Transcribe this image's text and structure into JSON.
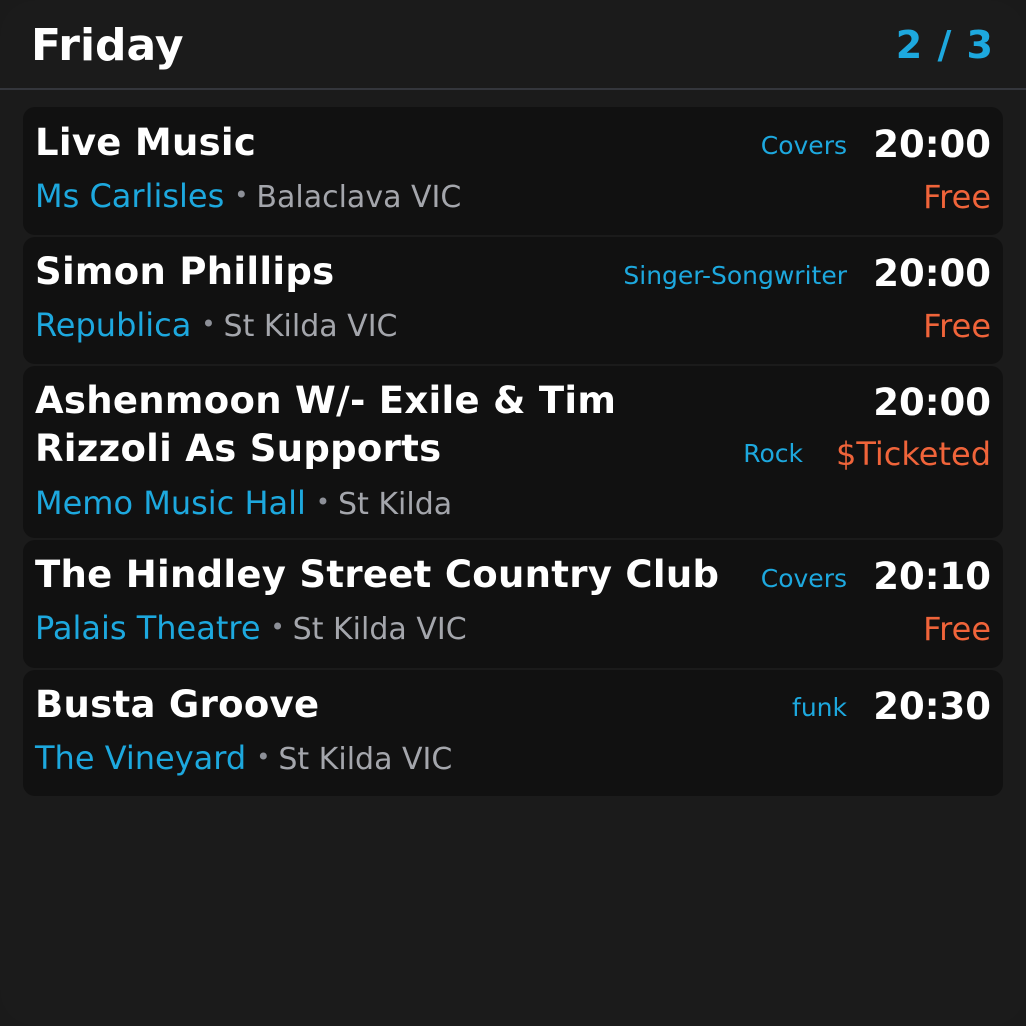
{
  "header": {
    "day": "Friday",
    "pager": "2 / 3"
  },
  "gigs": [
    {
      "title": "Live Music",
      "genre": "Covers",
      "time": "20:00",
      "venue": "Ms Carlisles",
      "suburb": "Balaclava VIC",
      "price": "Free"
    },
    {
      "title": "Simon Phillips",
      "genre": "Singer-Songwriter",
      "time": "20:00",
      "venue": "Republica",
      "suburb": "St Kilda VIC",
      "price": "Free"
    },
    {
      "title_line1": "Ashenmoon W/- Exile & Tim",
      "title_line2": "Rizzoli As Supports",
      "genre": "Rock",
      "time": "20:00",
      "venue": "Memo Music Hall",
      "suburb": "St Kilda",
      "price": "$Ticketed"
    },
    {
      "title": "The Hindley Street Country Club",
      "genre": "Covers",
      "time": "20:10",
      "venue": "Palais Theatre",
      "suburb": "St Kilda VIC",
      "price": "Free"
    },
    {
      "title": "Busta Groove",
      "genre": "funk",
      "time": "20:30",
      "venue": "The Vineyard",
      "suburb": "St Kilda VIC",
      "price": ""
    }
  ],
  "separator": "•",
  "colors": {
    "accent": "#1da8de",
    "price": "#f0643a",
    "card": "#111111",
    "background": "#1b1b1b"
  }
}
